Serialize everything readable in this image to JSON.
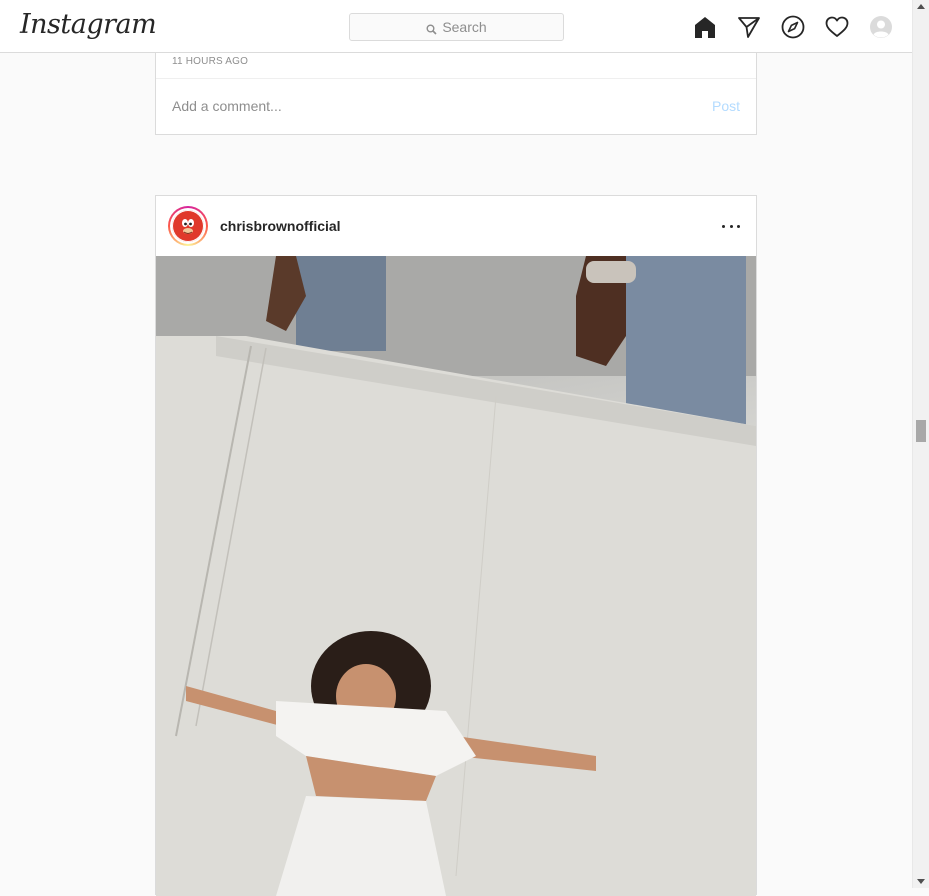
{
  "nav": {
    "logo": "Instagram",
    "search_placeholder": "Search",
    "icons": [
      "home-icon",
      "direct-icon",
      "explore-icon",
      "activity-heart-icon",
      "profile-avatar"
    ]
  },
  "previous_post": {
    "timestamp": "11 HOURS AGO",
    "comment_placeholder": "Add a comment...",
    "post_label": "Post"
  },
  "post": {
    "username": "chrisbrownofficial",
    "more_icon": "more-options-icon",
    "photo_description_icon": "photo"
  },
  "colors": {
    "post_button_disabled": "#b3dbff",
    "border": "#dbdbdb",
    "muted_text": "#8e8e8e"
  }
}
